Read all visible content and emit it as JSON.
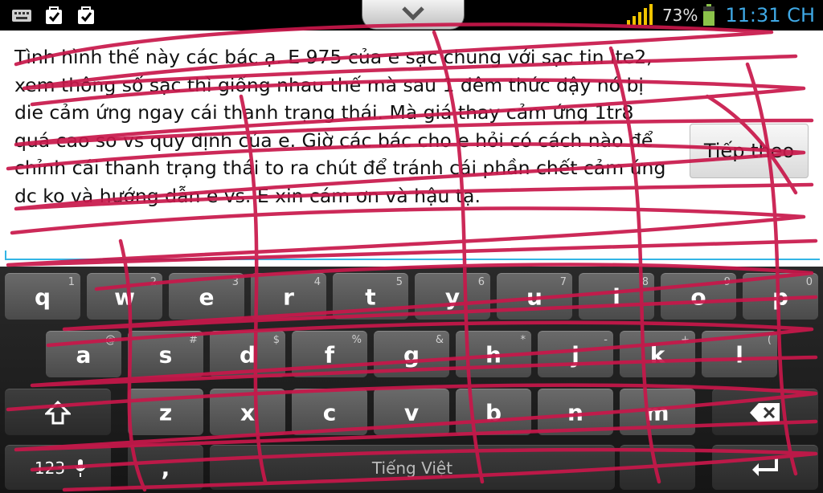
{
  "status_bar": {
    "icons": [
      "keyboard-icon",
      "task-done-icon",
      "task-done-icon"
    ],
    "battery_percent": "73%",
    "time": "11:31 CH"
  },
  "editor": {
    "text": "Tình hình thế này các bác ạ. E 975 của e sạc chung với sạc tin lte2, xem thông số sạc thì giống nhau thế mà sau 1 đêm thức dậy nó bị die cảm ứng ngay cái thanh trạng thái. Mà giá thay cảm ứng 1tr8 quá cao so vs quy định của e. Giờ các bác cho e hỏi có cách nào để chỉnh cái thanh trạng thái to ra chút để tránh cái phần chết cảm ứng dc ko và hướng dẫn e vs. E xin cám ơn và hậu tạ.",
    "next_button": "Tiếp theo"
  },
  "keyboard": {
    "row1": [
      {
        "key": "q",
        "hint": "1"
      },
      {
        "key": "w",
        "hint": "2"
      },
      {
        "key": "e",
        "hint": "3"
      },
      {
        "key": "r",
        "hint": "4"
      },
      {
        "key": "t",
        "hint": "5"
      },
      {
        "key": "y",
        "hint": "6"
      },
      {
        "key": "u",
        "hint": "7"
      },
      {
        "key": "i",
        "hint": "8"
      },
      {
        "key": "o",
        "hint": "9"
      },
      {
        "key": "p",
        "hint": "0"
      }
    ],
    "row2": [
      {
        "key": "a",
        "hint": "@"
      },
      {
        "key": "s",
        "hint": "#"
      },
      {
        "key": "d",
        "hint": "$"
      },
      {
        "key": "f",
        "hint": "%"
      },
      {
        "key": "g",
        "hint": "&"
      },
      {
        "key": "h",
        "hint": "*"
      },
      {
        "key": "j",
        "hint": "-"
      },
      {
        "key": "k",
        "hint": "+"
      },
      {
        "key": "l",
        "hint": "("
      }
    ],
    "row3": [
      {
        "key": "z",
        "hint": ""
      },
      {
        "key": "x",
        "hint": ""
      },
      {
        "key": "c",
        "hint": ""
      },
      {
        "key": "v",
        "hint": ""
      },
      {
        "key": "b",
        "hint": ""
      },
      {
        "key": "n",
        "hint": ""
      },
      {
        "key": "m",
        "hint": ""
      }
    ],
    "symbols_key": "123",
    "comma_key": ",",
    "space_label": "Tiếng Việt"
  },
  "colors": {
    "scribble": "#c8174a",
    "accent": "#33b5e5",
    "time": "#3fa9e6"
  }
}
